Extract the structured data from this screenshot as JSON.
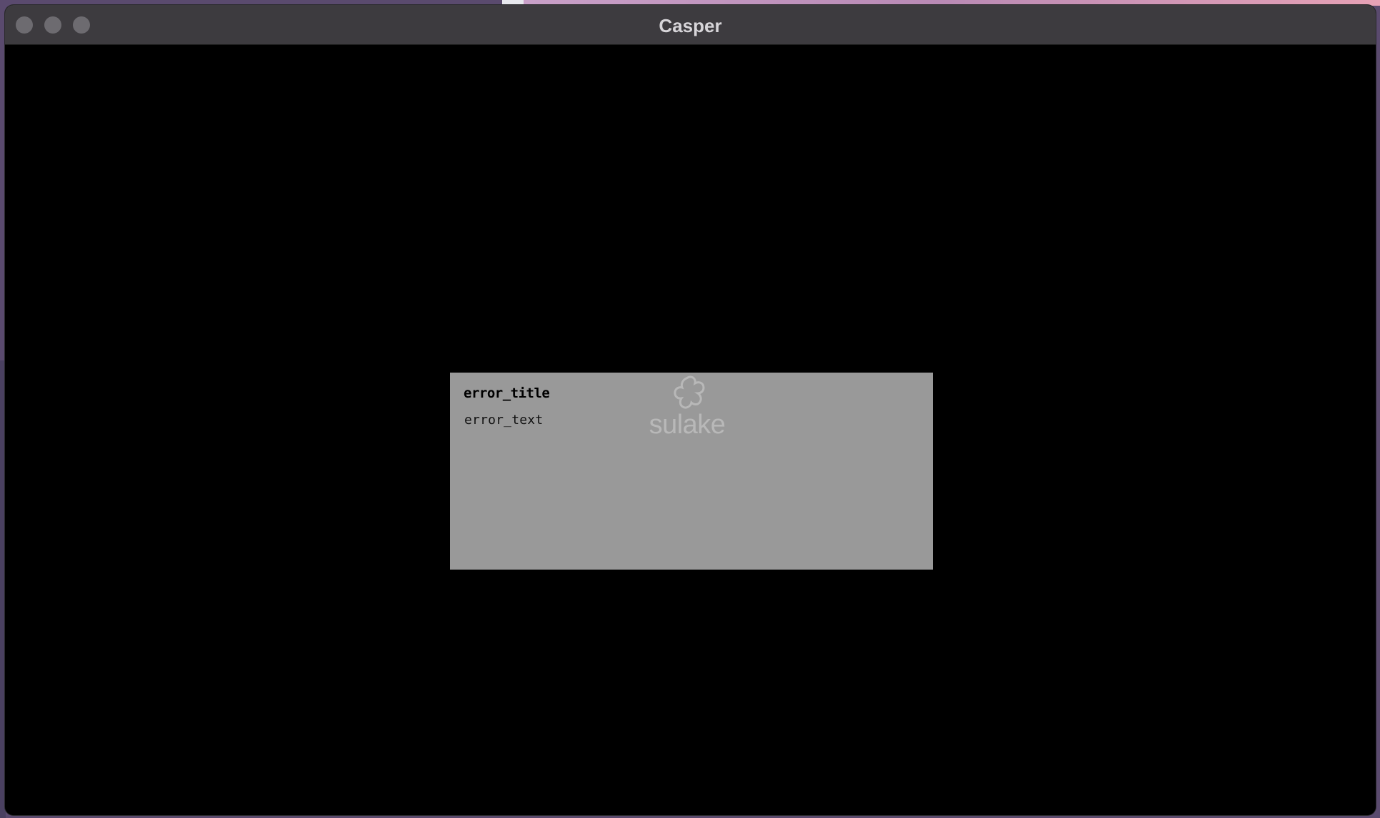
{
  "window": {
    "title": "Casper"
  },
  "dialog": {
    "title": "error_title",
    "text": "error_text",
    "logo_text": "sulake"
  },
  "icons": {
    "close": "close-traffic-light-icon",
    "minimize": "minimize-traffic-light-icon",
    "zoom": "zoom-traffic-light-icon",
    "logo": "sulake-logo-icon"
  },
  "colors": {
    "titlebar": "#3d3b3f",
    "content": "#000000",
    "dialog": "#999999",
    "traffic_light": "#6d6b70"
  }
}
